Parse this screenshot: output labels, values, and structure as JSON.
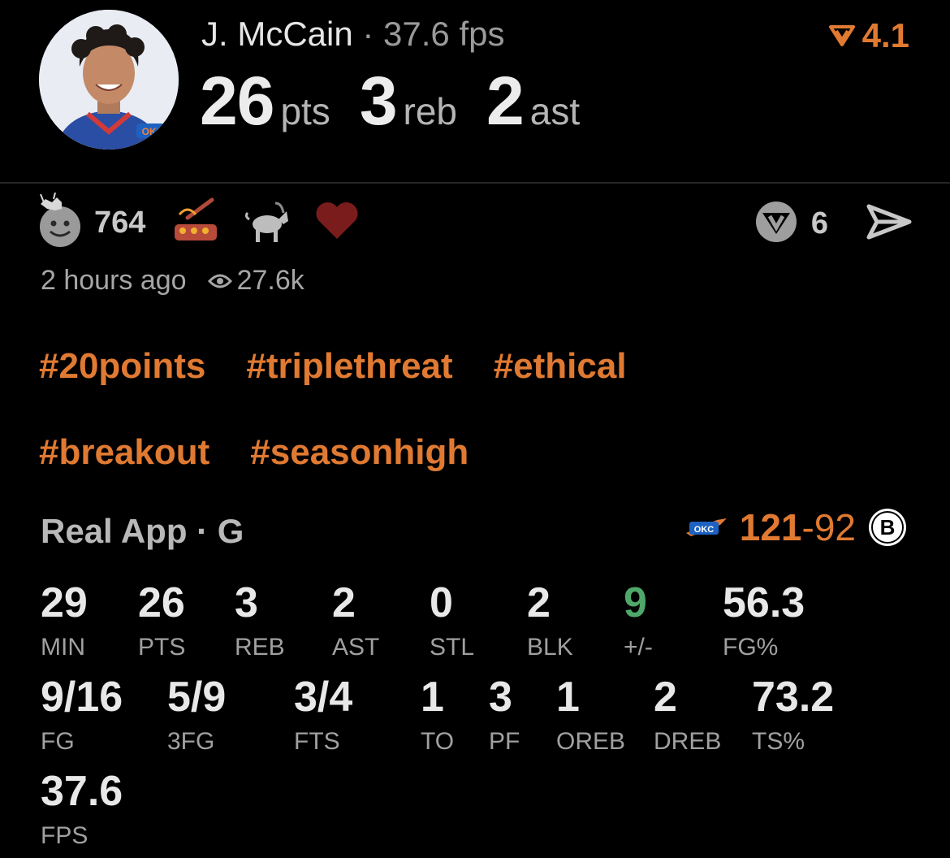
{
  "header": {
    "player_name": "J. McCain",
    "separator": "·",
    "fps": "37.6 fps",
    "rating": "4.1",
    "pts_value": "26",
    "pts_unit": "pts",
    "reb_value": "3",
    "reb_unit": "reb",
    "ast_value": "2",
    "ast_unit": "ast"
  },
  "reactions": {
    "count": "764",
    "share_count": "6"
  },
  "meta": {
    "time_ago": "2 hours ago",
    "views": "27.6k"
  },
  "hashtags": [
    "#20points",
    "#triplethreat",
    "#ethical",
    "#breakout",
    "#seasonhigh"
  ],
  "game": {
    "label": "Real App · G",
    "score_home": "121",
    "score_dash": "-",
    "score_away": "92"
  },
  "stats": {
    "min": {
      "v": "29",
      "l": "MIN"
    },
    "pts": {
      "v": "26",
      "l": "PTS"
    },
    "reb": {
      "v": "3",
      "l": "REB"
    },
    "ast": {
      "v": "2",
      "l": "AST"
    },
    "stl": {
      "v": "0",
      "l": "STL"
    },
    "blk": {
      "v": "2",
      "l": "BLK"
    },
    "pm": {
      "v": "9",
      "l": "+/-"
    },
    "fgp": {
      "v": "56.3",
      "l": "FG%"
    },
    "fg": {
      "v": "9/16",
      "l": "FG"
    },
    "fg3": {
      "v": "5/9",
      "l": "3FG"
    },
    "fts": {
      "v": "3/4",
      "l": "FTS"
    },
    "to": {
      "v": "1",
      "l": "TO"
    },
    "pf": {
      "v": "3",
      "l": "PF"
    },
    "oreb": {
      "v": "1",
      "l": "OREB"
    },
    "dreb": {
      "v": "2",
      "l": "DREB"
    },
    "tsp": {
      "v": "73.2",
      "l": "TS%"
    },
    "fps": {
      "v": "37.6",
      "l": "FPS"
    }
  },
  "colors": {
    "accent": "#e07a32",
    "positive": "#4fa86a",
    "background": "#000000"
  },
  "icons": [
    "avatar-photo",
    "rating-chevron-icon",
    "goat-smiley-icon",
    "cooking-icon",
    "goat-icon",
    "heart-icon",
    "real-logo-icon",
    "send-icon",
    "eye-icon",
    "okc-logo-icon",
    "nets-logo-icon"
  ]
}
